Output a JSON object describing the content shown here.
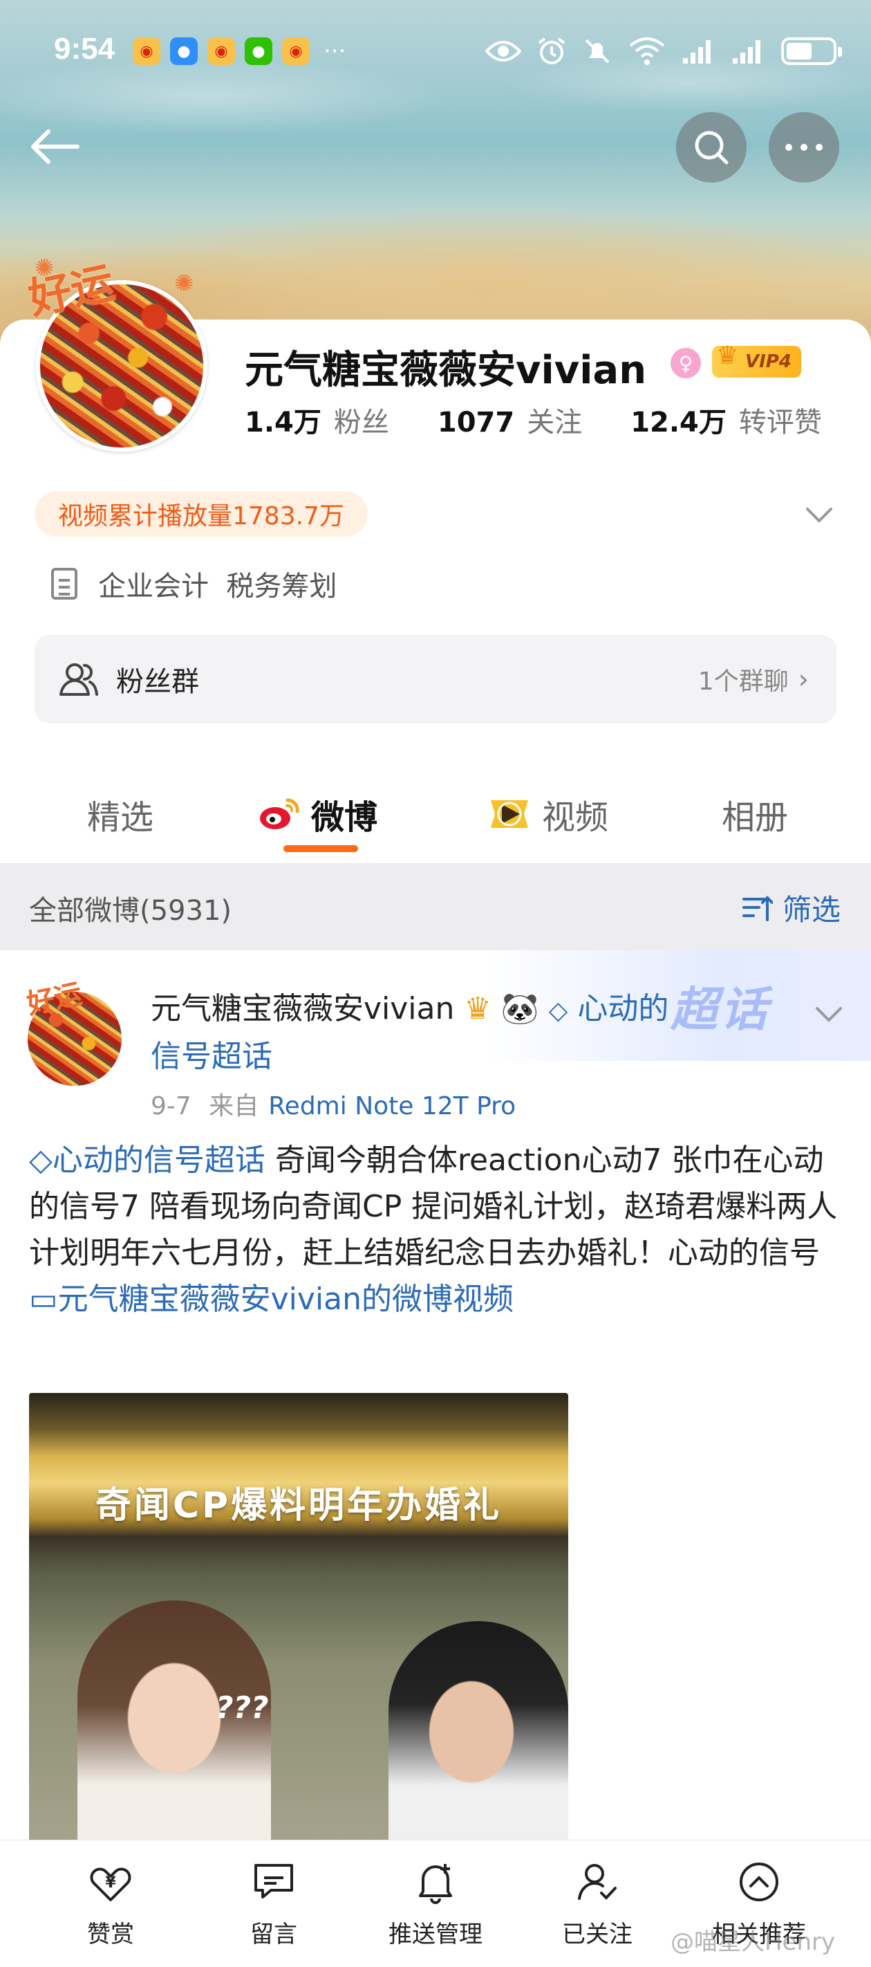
{
  "status_bar": {
    "time": "9:54",
    "dots": "···"
  },
  "profile": {
    "name": "元气糖宝薇薇安vivian",
    "gender_symbol": "♀",
    "vip_label": "VIP4",
    "badge_text": "好运",
    "stats": [
      {
        "value": "1.4万",
        "label": "粉丝"
      },
      {
        "value": "1077",
        "label": "关注"
      },
      {
        "value": "12.4万",
        "label": "转评赞"
      }
    ],
    "video_plays": "视频累计播放量1783.7万",
    "business": "企业会计  税务筹划",
    "fan_group": {
      "label": "粉丝群",
      "count": "1个群聊"
    }
  },
  "tabs": [
    {
      "label": "精选"
    },
    {
      "label": "微博"
    },
    {
      "label": "视频"
    },
    {
      "label": "相册"
    }
  ],
  "section": {
    "title": "全部微博(5931)",
    "filter": "筛选"
  },
  "post": {
    "author": "元气糖宝薇薇安vivian",
    "topic_inline": "心动的",
    "topic_inline_2": "信号超话",
    "chaohua_tag": "超话",
    "date": "9-7",
    "from_label": "来自",
    "source": "Redmi Note 12T Pro",
    "body_topic": "心动的信号超话",
    "body_text": " 奇闻今朝合体reaction心动7  张巾在心动的信号7  陪看现场向奇闻CP  提问婚礼计划，赵琦君爆料两人计划明年六七月份，赶上结婚纪念日去办婚礼！心动的信号 ",
    "video_link": "元气糖宝薇薇安vivian的微博视频",
    "video_caption": "奇闻CP爆料明年办婚礼",
    "video_marks": "???"
  },
  "bottom_bar": [
    {
      "label": "赞赏",
      "icon": "reward-icon"
    },
    {
      "label": "留言",
      "icon": "message-icon"
    },
    {
      "label": "推送管理",
      "icon": "bell-plus-icon"
    },
    {
      "label": "已关注",
      "icon": "user-check-icon"
    },
    {
      "label": "相关推荐",
      "icon": "chevron-up-circle-icon"
    }
  ],
  "watermark": "@喵星人Henry",
  "colors": {
    "accent": "#ff6a13",
    "link": "#2b6bb8",
    "pill_bg": "#fff0e2",
    "pill_text": "#f25c18"
  }
}
